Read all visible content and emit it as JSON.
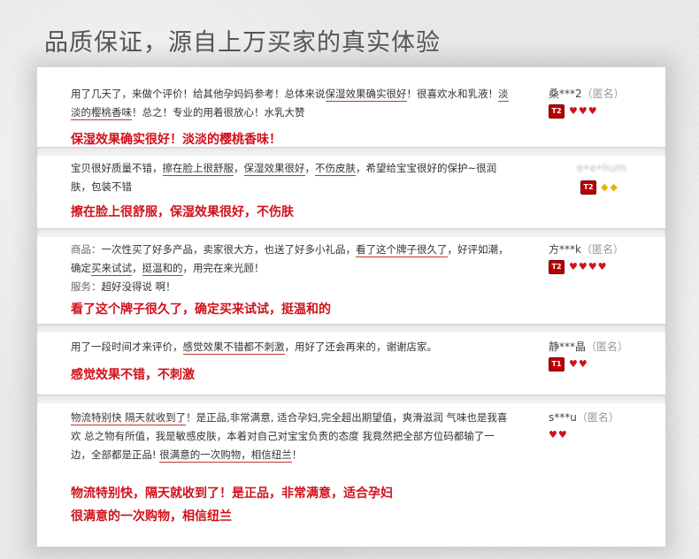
{
  "title": "品质保证，源自上万买家的真实体验",
  "reviews": [
    {
      "body_html": "用了几天了，来做个评价！给其他孕妈妈参考！总体来说<u class=\"hl\">保湿效果确实很好</u>！很喜欢水和乳液！<u class=\"hl\">淡淡的樱桃香味</u>！总之！专业的用着很放心！水乳大赞",
      "summary": "保湿效果确实很好！淡淡的樱桃香味！",
      "user": "桑***2",
      "anon": "（匿名）",
      "level": "T2",
      "hearts": 3,
      "diamonds": 0
    },
    {
      "body_html": "宝贝很好质量不错，<u class=\"hl\">擦在脸上很舒服</u>，<u class=\"hl\">保湿效果很好</u>，<u class=\"hl\">不伤皮肤</u>，希望给宝宝很好的保护~很润肤，包装不错",
      "summary": "擦在脸上很舒服，保湿效果很好，不伤肤",
      "user": "e•e•hum",
      "anon": "",
      "level": "T2",
      "hearts": 0,
      "diamonds": 2
    },
    {
      "body_html": "<span class=\"lbl\">商品：</span>一次性买了好多产品，卖家很大方，也送了好多小礼品，<u class=\"hl\">看了这个牌子很久了</u>，好评如潮，确定<u class=\"hl\">买来试试</u>，<u class=\"hl\">挺温和的</u>，用完在来光顾！<br><span class=\"lbl\">服务：</span>超好没得说 啊！",
      "summary": "看了这个牌子很久了，确定买来试试，挺温和的",
      "user": "方***k",
      "anon": "（匿名）",
      "level": "T2",
      "hearts": 4,
      "diamonds": 0
    },
    {
      "body_html": "用了一段时间才来评价，<u class=\"hl\">感觉效果不错都不刺激</u>，用好了还会再来的，谢谢店家。",
      "summary": "感觉效果不错，不刺激",
      "user": "静***晶",
      "anon": "（匿名）",
      "level": "T1",
      "hearts": 2,
      "diamonds": 0
    },
    {
      "body_html": "<u class=\"hl\">物流特别快 隔天就收到了</u>！是正品,非常满意, 适合孕妇,完全超出期望值，爽滑滋润 气味也是我喜欢 总之物有所值，我是敏感皮肤，本着对自己对宝宝负责的态度 我竟然把全部方位码都输了一边，全部都是正品! <u class=\"hl\">很满意的一次购物，相信纽兰</u>！",
      "summary": "物流特别快，隔天就收到了！是正品，非常满意，适合孕妇",
      "summary2": "很满意的一次购物，相信纽兰",
      "user": "s***u",
      "anon": "（匿名）",
      "level": "",
      "hearts": 2,
      "diamonds": 0
    }
  ]
}
